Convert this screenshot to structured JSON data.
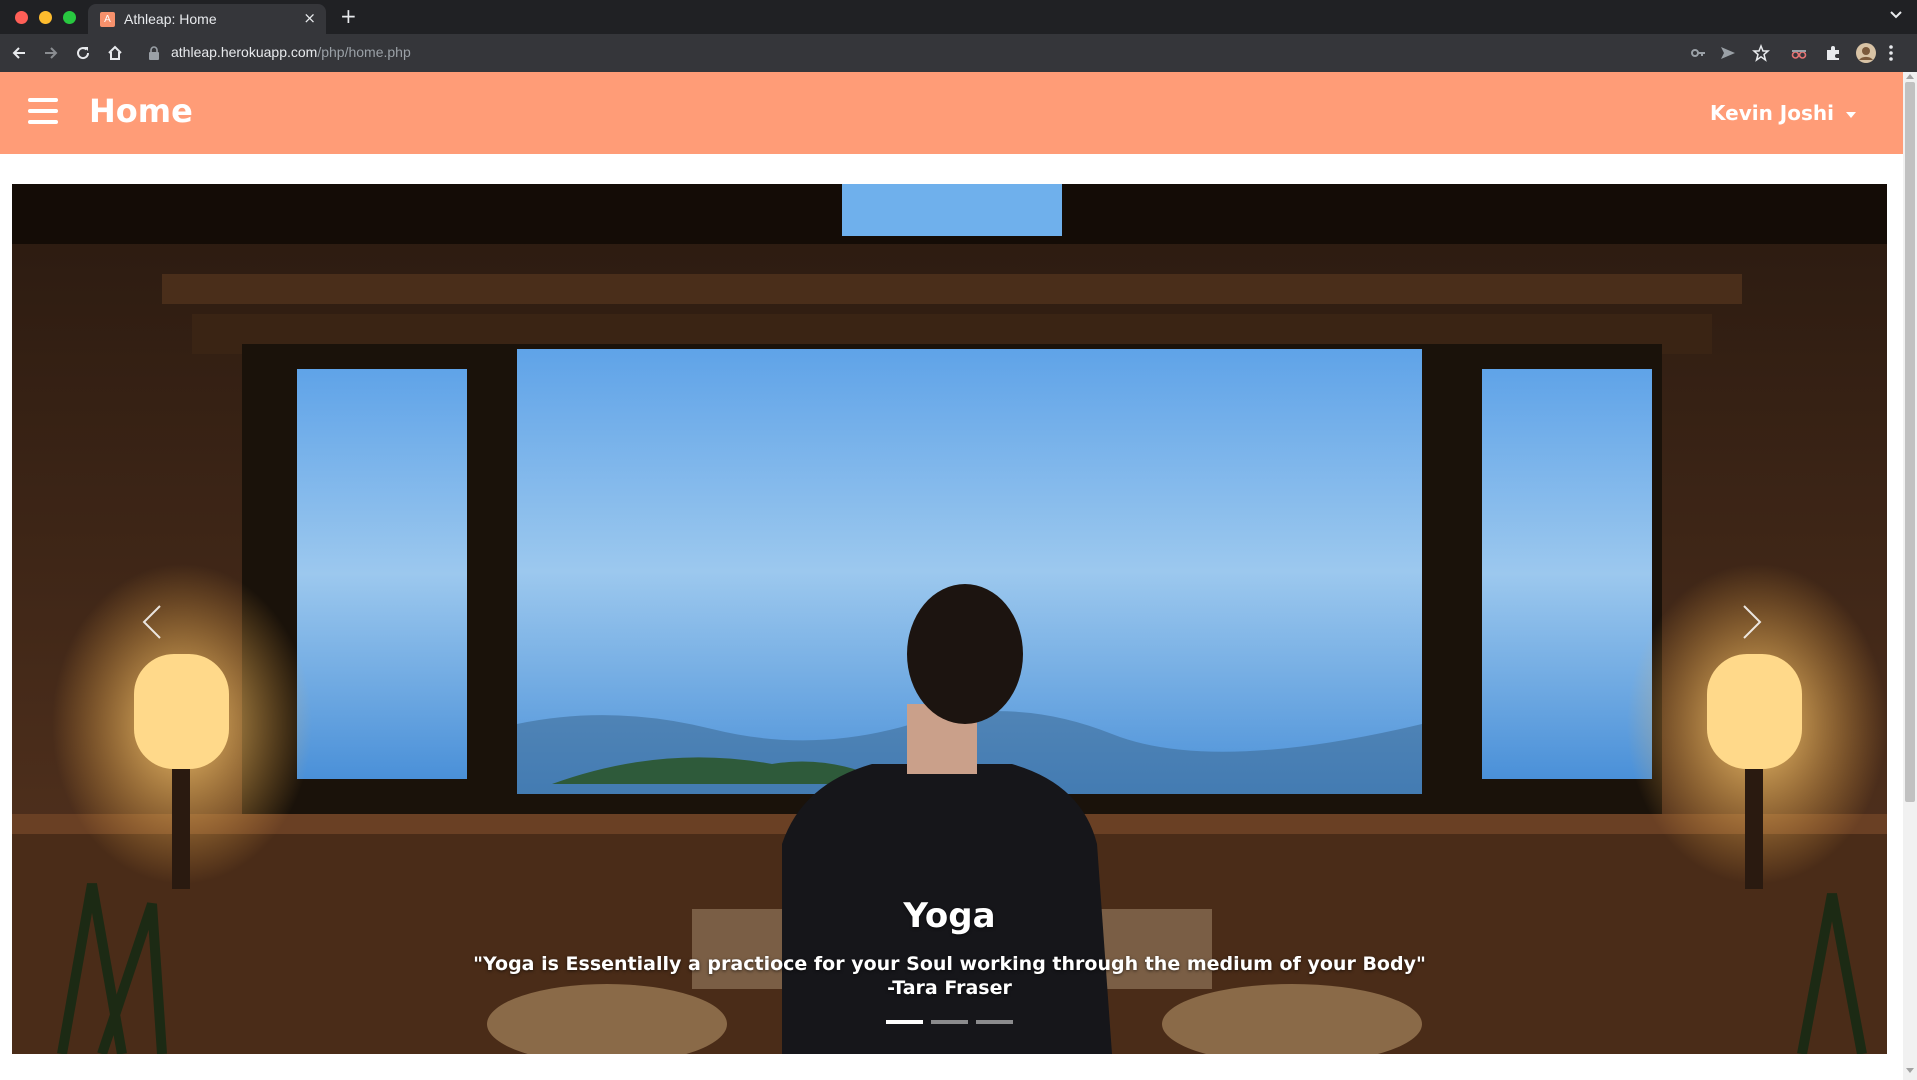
{
  "browser": {
    "tab": {
      "title": "Athleap: Home",
      "favicon_letter": "A",
      "close_glyph": "×"
    },
    "new_tab_glyph": "+",
    "address": {
      "host": "athleap.herokuapp.com",
      "path": "/php/home.php"
    },
    "icons": [
      "back-icon",
      "forward-icon",
      "reload-icon",
      "home-icon",
      "lock-icon",
      "key-icon",
      "send-icon",
      "star-icon",
      "incognito-extension-icon",
      "puzzle-icon",
      "profile-avatar-icon",
      "kebab-menu-icon"
    ]
  },
  "navbar": {
    "title": "Home",
    "user_name": "Kevin Joshi",
    "background": "#ff9c77"
  },
  "carousel": {
    "slides_count": 3,
    "active_index": 0,
    "caption": {
      "title": "Yoga",
      "quote": "\"Yoga is Essentially a practioce for your Soul working through the medium of your Body\"",
      "author": "-Tara Fraser"
    }
  }
}
